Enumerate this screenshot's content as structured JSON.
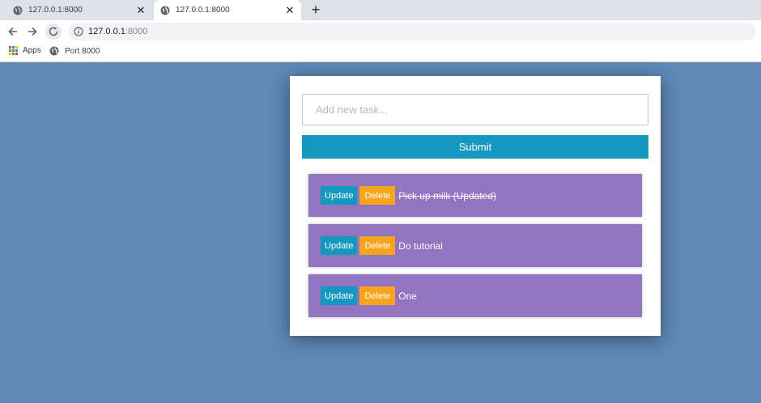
{
  "browser": {
    "tabs": [
      {
        "title": "127.0.0.1:8000"
      },
      {
        "title": "127.0.0.1:8000"
      }
    ],
    "close_glyph": "✕",
    "new_tab_glyph": "+",
    "url_host": "127.0.0.1",
    "url_port": ":8000",
    "bookmarks": [
      {
        "label": "Apps",
        "icon": "apps-grid-icon"
      },
      {
        "label": "Port 8000",
        "icon": "globe-icon"
      }
    ]
  },
  "app": {
    "input_placeholder": "Add new task...",
    "input_value": "",
    "submit_label": "Submit",
    "update_label": "Update",
    "delete_label": "Delete",
    "tasks": [
      {
        "title": "Pick up milk (Updated)",
        "completed": true
      },
      {
        "title": "Do tutorial",
        "completed": false
      },
      {
        "title": "One",
        "completed": false
      }
    ]
  },
  "colors": {
    "background": "#6089b8",
    "primary": "#1598c0",
    "warning": "#f5a41c",
    "task_bg": "#9374c1"
  }
}
